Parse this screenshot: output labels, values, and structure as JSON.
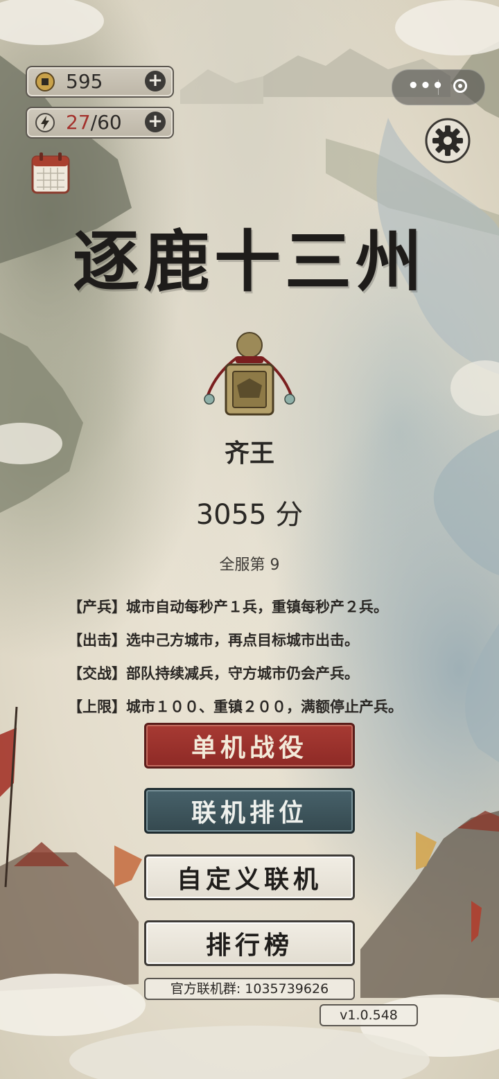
{
  "resources": {
    "coins": {
      "value": "595",
      "icon": "coin-icon"
    },
    "energy": {
      "current": "27",
      "separator": "/",
      "max": "60",
      "icon": "lightning-icon"
    }
  },
  "capsule": {
    "menu_icon": "more-dots-icon",
    "close_icon": "target-icon"
  },
  "title": "逐鹿十三州",
  "player": {
    "rank_title": "齐王",
    "score": "3055 分",
    "server_rank": "全服第 9"
  },
  "rules": [
    "【产兵】城市自动每秒产１兵，重镇每秒产２兵。",
    "【出击】选中己方城市，再点目标城市出击。",
    "【交战】部队持续减兵，守方城市仍会产兵。",
    "【上限】城市１００、重镇２００，满额停止产兵。"
  ],
  "buttons": {
    "single_player": "单机战役",
    "ranked_online": "联机排位",
    "custom_online": "自定义联机",
    "leaderboard": "排行榜"
  },
  "footer": {
    "group": "官方联机群: 1035739626",
    "version": "v1.0.548"
  },
  "colors": {
    "primary_red": "#9a302b",
    "primary_blue": "#3e555c",
    "ink": "#1e1c1a"
  }
}
